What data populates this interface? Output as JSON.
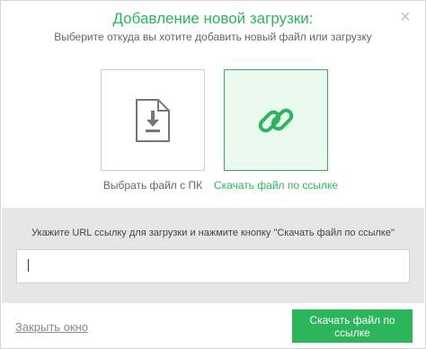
{
  "dialog": {
    "close_icon": "close-icon",
    "title": "Добавление новой загрузки:",
    "subtitle": "Выберите откуда вы хотите добавить новый файл или загрузку",
    "accent_color": "#2cb55a"
  },
  "options": {
    "pc": {
      "label": "Выбрать файл с ПК",
      "icon": "file-download-icon",
      "selected": false
    },
    "link": {
      "label": "Скачать файл по ссылке",
      "icon": "link-icon",
      "selected": true
    }
  },
  "url_panel": {
    "hint": "Укажите URL ссылку для загрузки и нажмите кнопку \"Скачать файл по ссылке\"",
    "input_value": "",
    "input_placeholder": ""
  },
  "footer": {
    "close_label": "Закрыть окно",
    "download_label": "Скачать файл по ссылке"
  }
}
